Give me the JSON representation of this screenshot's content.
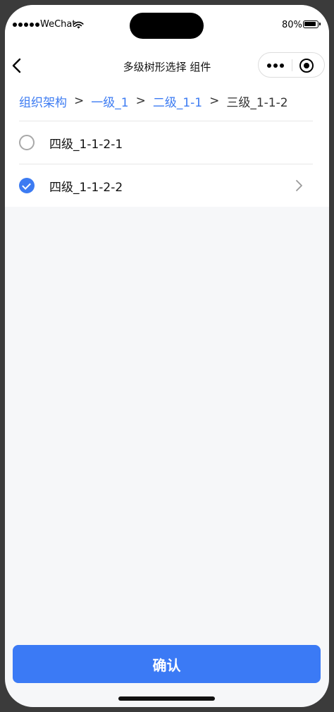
{
  "status_bar": {
    "carrier": "WeChat",
    "battery": "80%"
  },
  "nav": {
    "title": "多级树形选择 组件"
  },
  "breadcrumb": [
    {
      "label": "组织架构",
      "active": false
    },
    {
      "label": "一级_1",
      "active": false
    },
    {
      "label": "二级_1-1",
      "active": false
    },
    {
      "label": "三级_1-1-2",
      "active": true
    }
  ],
  "breadcrumb_separator": ">",
  "items": [
    {
      "label": "四级_1-1-2-1",
      "checked": false,
      "has_children": false
    },
    {
      "label": "四级_1-1-2-2",
      "checked": true,
      "has_children": true
    }
  ],
  "confirm_label": "确认",
  "colors": {
    "accent": "#3c7bf2",
    "button": "#3b7af5",
    "background": "#f6f7f9"
  }
}
